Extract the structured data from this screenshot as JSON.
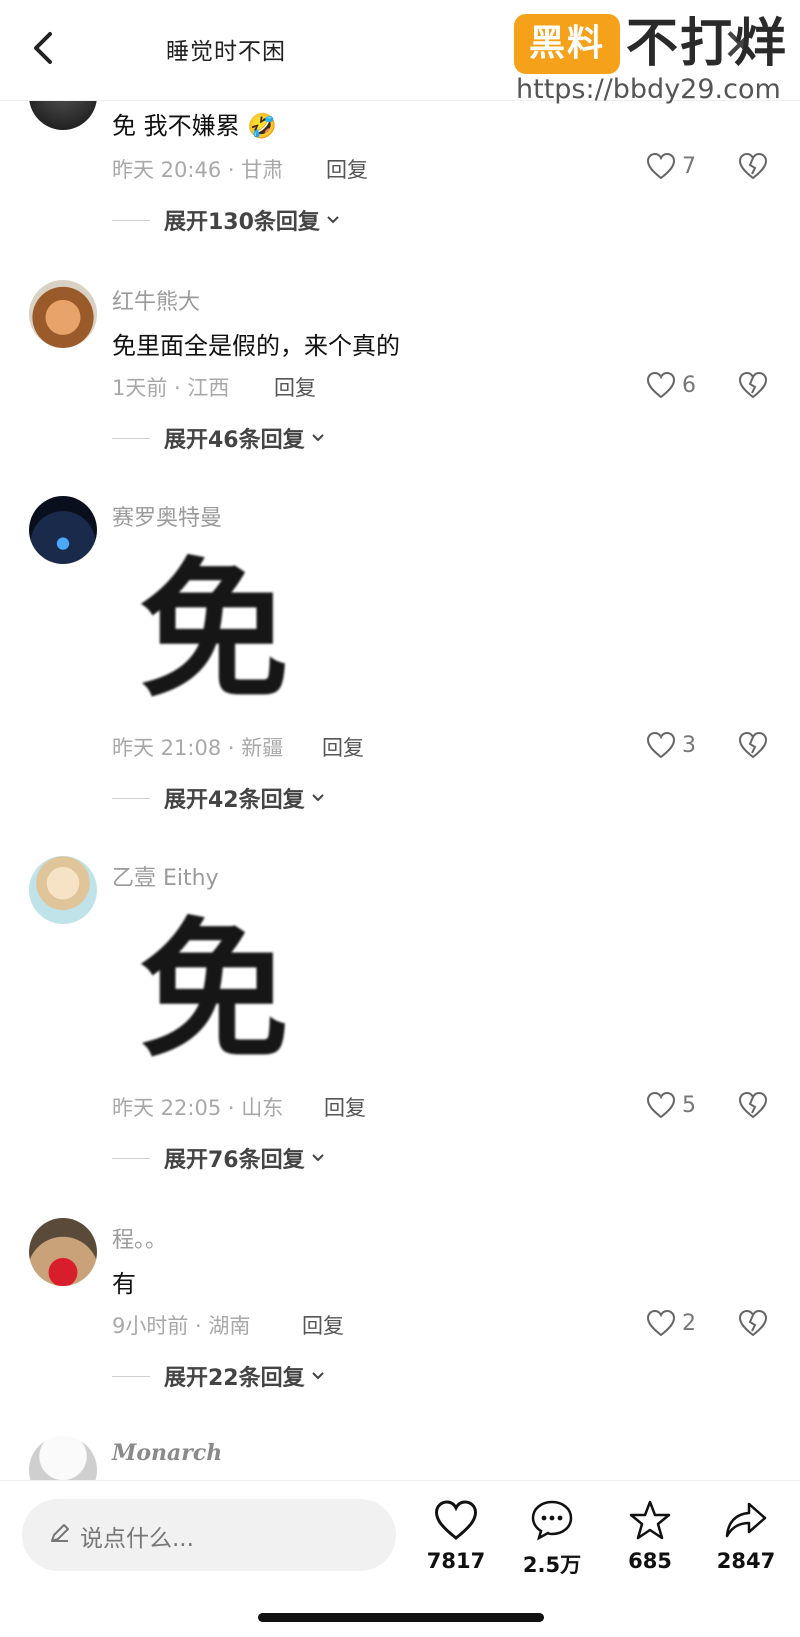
{
  "header": {
    "title": "睡觉时不困",
    "watermark_logo": "黑料",
    "watermark_text": "不打烊",
    "watermark_url": "https://bbdy29.com"
  },
  "comments": [
    {
      "username": "",
      "text": "免 我不嫌累",
      "emoji": "🤣",
      "meta": "昨天 20:46 · 甘肃",
      "reply": "回复",
      "likes": "7",
      "expand": "展开130条回复"
    },
    {
      "username": "红牛熊大",
      "text": "免里面全是假的，来个真的",
      "meta": "1天前 · 江西",
      "reply": "回复",
      "likes": "6",
      "expand": "展开46条回复"
    },
    {
      "username": "赛罗奥特曼",
      "sticker": "免",
      "meta": "昨天 21:08 · 新疆",
      "reply": "回复",
      "likes": "3",
      "expand": "展开42条回复"
    },
    {
      "username": "乙壹 Eithy",
      "sticker": "免",
      "meta": "昨天 22:05 · 山东",
      "reply": "回复",
      "likes": "5",
      "expand": "展开76条回复"
    },
    {
      "username": "程。。",
      "text": "有",
      "meta": "9小时前 · 湖南",
      "reply": "回复",
      "likes": "2",
      "expand": "展开22条回复"
    },
    {
      "username": "Monarch"
    }
  ],
  "bottom_bar": {
    "placeholder": "说点什么...",
    "likes": "7817",
    "comments": "2.5万",
    "favorites": "685",
    "shares": "2847"
  }
}
